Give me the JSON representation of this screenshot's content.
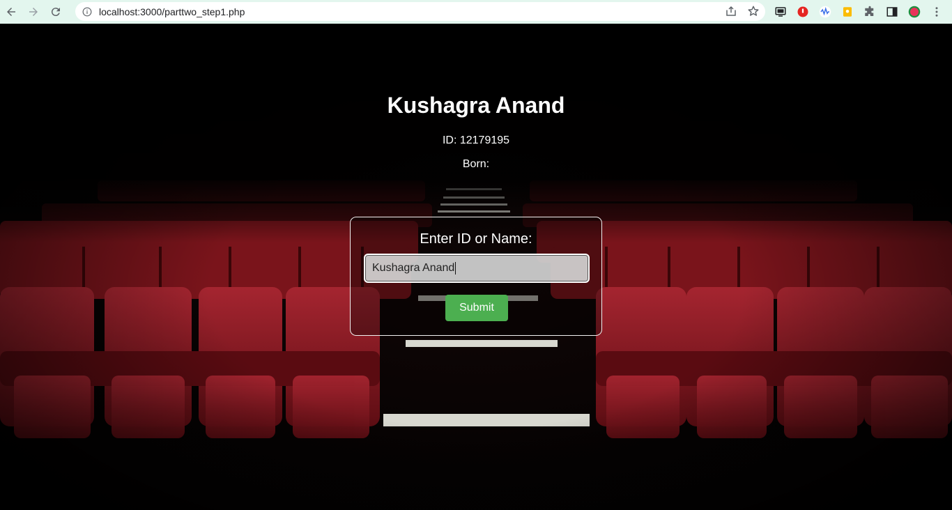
{
  "browser": {
    "url": "localhost:3000/parttwo_step1.php",
    "icons": [
      "back-icon",
      "forward-icon",
      "reload-icon",
      "info-icon",
      "share-icon",
      "star-icon"
    ],
    "extensions": [
      "cast-icon",
      "shield-extension-icon",
      "wave-extension-icon",
      "keep-extension-icon",
      "puzzle-icon",
      "side-panel-icon",
      "profile-avatar",
      "menu-icon"
    ]
  },
  "page": {
    "title": "Kushagra Anand",
    "id_line": "ID: 12179195",
    "born_line": "Born:",
    "form": {
      "label": "Enter ID or Name:",
      "input_value": "Kushagra Anand",
      "submit_label": "Submit"
    }
  },
  "colors": {
    "chrome_bg": "#e3f6ee",
    "seat_red": "#8e1a22",
    "submit_green": "#4caf50"
  }
}
